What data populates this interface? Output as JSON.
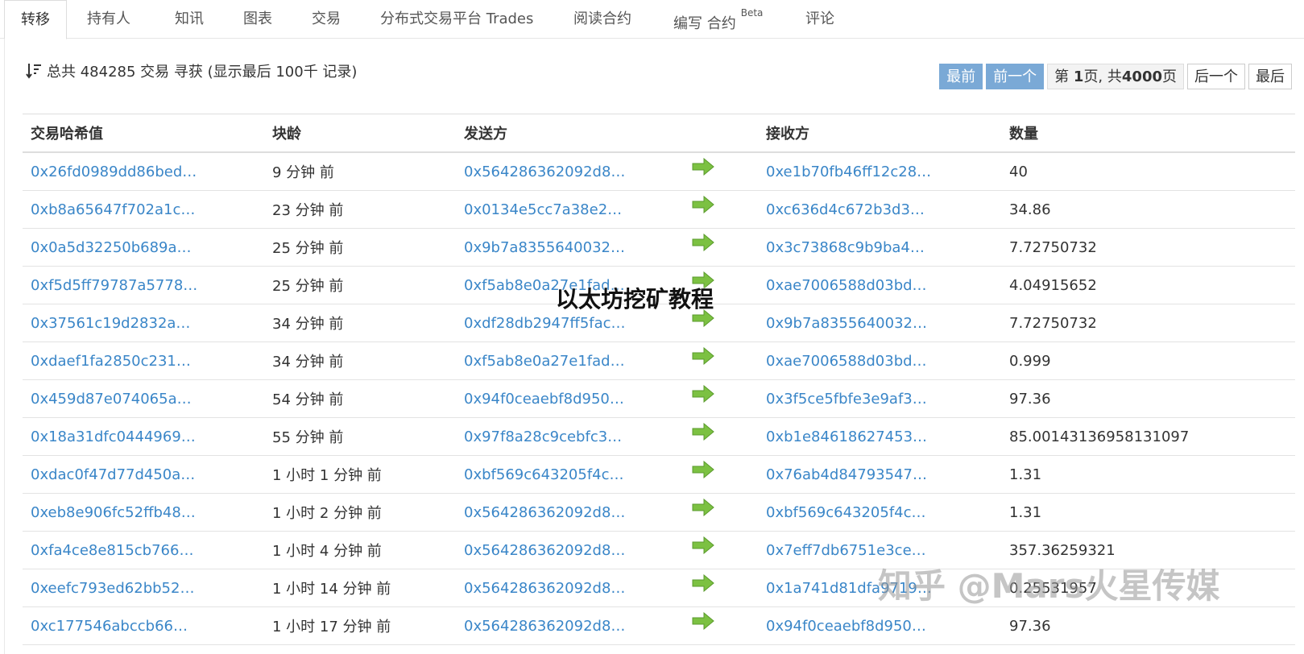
{
  "tabs": [
    {
      "label": "转移",
      "active": true
    },
    {
      "label": "持有人"
    },
    {
      "label": "知讯"
    },
    {
      "label": "图表"
    },
    {
      "label": "交易"
    },
    {
      "label": "分布式交易平台 Trades"
    },
    {
      "label": "阅读合约"
    },
    {
      "label": "编写 合约",
      "badge": "Beta"
    },
    {
      "label": "评论"
    }
  ],
  "summary": {
    "icon": "sort-icon",
    "text": "总共 484285 交易 寻获 (显示最后 100千 记录)"
  },
  "pager": {
    "first": "最前",
    "prev": "前一个",
    "info_prefix": "第 ",
    "current_page": "1",
    "info_middle": "页, 共",
    "total_pages": "4000",
    "info_suffix": "页",
    "next": "后一个",
    "last": "最后"
  },
  "table": {
    "headers": {
      "hash": "交易哈希值",
      "age": "块龄",
      "from": "发送方",
      "to": "接收方",
      "amount": "数量"
    },
    "rows": [
      {
        "hash": "0x26fd0989dd86bed…",
        "age": "9 分钟 前",
        "from": "0x564286362092d8…",
        "to": "0xe1b70fb46ff12c28…",
        "amount": "40"
      },
      {
        "hash": "0xb8a65647f702a1c…",
        "age": "23 分钟 前",
        "from": "0x0134e5cc7a38e2…",
        "to": "0xc636d4c672b3d3…",
        "amount": "34.86"
      },
      {
        "hash": "0x0a5d32250b689a…",
        "age": "25 分钟 前",
        "from": "0x9b7a8355640032…",
        "to": "0x3c73868c9b9ba4…",
        "amount": "7.72750732"
      },
      {
        "hash": "0xf5d5ff79787a5778…",
        "age": "25 分钟 前",
        "from": "0xf5ab8e0a27e1fad…",
        "to": "0xae7006588d03bd…",
        "amount": "4.04915652"
      },
      {
        "hash": "0x37561c19d2832a…",
        "age": "34 分钟 前",
        "from": "0xdf28db2947ff5fac…",
        "to": "0x9b7a8355640032…",
        "amount": "7.72750732"
      },
      {
        "hash": "0xdaef1fa2850c231…",
        "age": "34 分钟 前",
        "from": "0xf5ab8e0a27e1fad…",
        "to": "0xae7006588d03bd…",
        "amount": "0.999"
      },
      {
        "hash": "0x459d87e074065a…",
        "age": "54 分钟 前",
        "from": "0x94f0ceaebf8d950…",
        "to": "0x3f5ce5fbfe3e9af3…",
        "amount": "97.36"
      },
      {
        "hash": "0x18a31dfc0444969…",
        "age": "55 分钟 前",
        "from": "0x97f8a28c9cebfc3…",
        "to": "0xb1e84618627453…",
        "amount": "85.00143136958131097"
      },
      {
        "hash": "0xdac0f47d77d450a…",
        "age": "1 小时 1 分钟 前",
        "from": "0xbf569c643205f4c…",
        "to": "0x76ab4d84793547…",
        "amount": "1.31"
      },
      {
        "hash": "0xeb8e906fc52ffb48…",
        "age": "1 小时 2 分钟 前",
        "from": "0x564286362092d8…",
        "to": "0xbf569c643205f4c…",
        "amount": "1.31"
      },
      {
        "hash": "0xfa4ce8e815cb766…",
        "age": "1 小时 4 分钟 前",
        "from": "0x564286362092d8…",
        "to": "0x7eff7db6751e3ce…",
        "amount": "357.36259321"
      },
      {
        "hash": "0xeefc793ed62bb52…",
        "age": "1 小时 14 分钟 前",
        "from": "0x564286362092d8…",
        "to": "0x1a741d81dfa9719…",
        "amount": "0.25531957"
      },
      {
        "hash": "0xc177546abccb66…",
        "age": "1 小时 17 分钟 前",
        "from": "0x564286362092d8…",
        "to": "0x94f0ceaebf8d950…",
        "amount": "97.36"
      }
    ]
  },
  "overlay_text": "以太坊挖矿教程",
  "watermark": "知乎 @Mars火星传媒",
  "colors": {
    "link": "#3a86c8",
    "pager_disabled": "#7aa9d6",
    "arrow": "#7cc142"
  }
}
